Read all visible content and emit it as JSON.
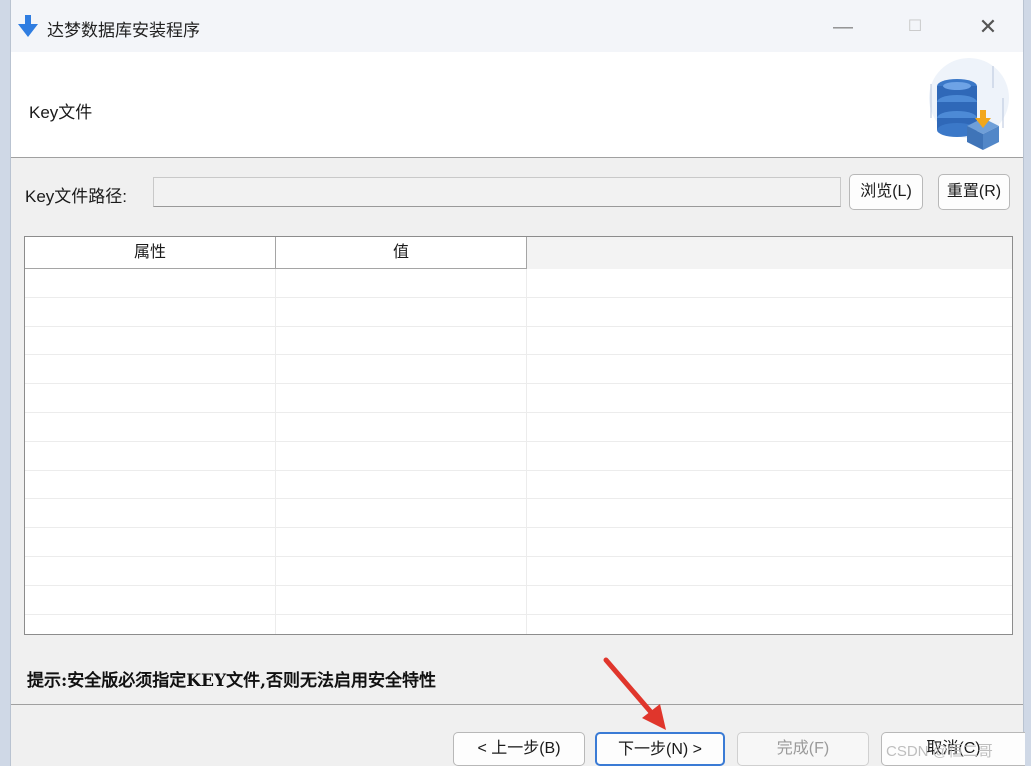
{
  "window": {
    "title": "达梦数据库安装程序",
    "controls": {
      "minimize": "—",
      "maximize": "☐",
      "close": "✕"
    }
  },
  "header": {
    "title": "Key文件",
    "logo_icon": "database-install-icon"
  },
  "key_path": {
    "label": "Key文件路径:",
    "value": "",
    "browse_label": "浏览(L)",
    "reset_label": "重置(R)"
  },
  "table": {
    "columns": [
      "属性",
      "值"
    ],
    "rows": []
  },
  "hint": "提示:安全版必须指定KEY文件,否则无法启用安全特性",
  "footer": {
    "prev_label": "< 上一步(B)",
    "next_label": "下一步(N) >",
    "finish_label": "完成(F)",
    "cancel_label": "取消(C)"
  },
  "watermark": "CSDN @恒二哥",
  "colors": {
    "accent": "#3a7bd5",
    "annotation_arrow": "#e0362c",
    "app_icon": "#2f7de1"
  }
}
